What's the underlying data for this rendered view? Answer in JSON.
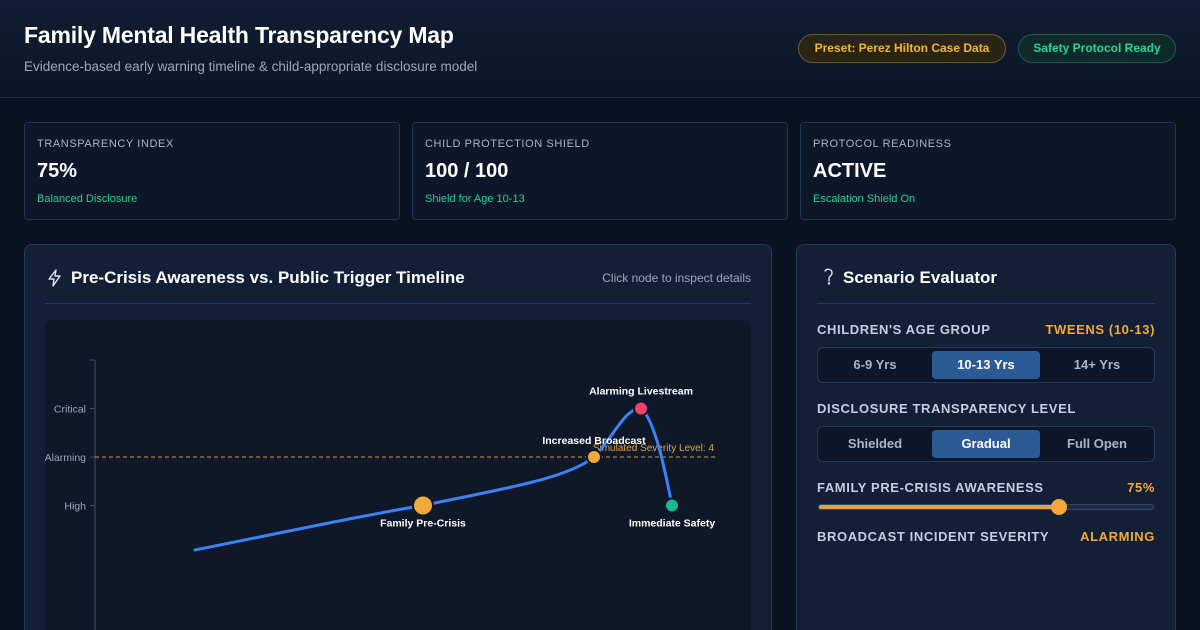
{
  "header": {
    "title": "Family Mental Health Transparency Map",
    "subtitle": "Evidence-based early warning timeline & child-appropriate disclosure model",
    "preset_badge": "Preset: Perez Hilton Case Data",
    "safety_badge": "Safety Protocol Ready"
  },
  "stats": [
    {
      "label": "TRANSPARENCY INDEX",
      "value": "75%",
      "note": "Balanced Disclosure"
    },
    {
      "label": "CHILD PROTECTION SHIELD",
      "value": "100 / 100",
      "note": "Shield for Age 10-13"
    },
    {
      "label": "PROTOCOL READINESS",
      "value": "ACTIVE",
      "note": "Escalation Shield On"
    }
  ],
  "timeline": {
    "title": "Pre-Crisis Awareness vs. Public Trigger Timeline",
    "hint": "Click node to inspect details",
    "threshold_label": "Simulated Severity Level: 4"
  },
  "chart_data": {
    "type": "line",
    "y_categories": [
      "High",
      "Alarming",
      "Critical"
    ],
    "y_levels": {
      "High": 3,
      "Alarming": 4,
      "Critical": 5
    },
    "threshold": 4,
    "series": [
      {
        "points": [
          {
            "label": "Family Pre-Crisis",
            "y": 3.0,
            "color": "#f2a93a"
          },
          {
            "label": "Increased Broadcast",
            "y": 4.0,
            "color": "#f2a93a"
          },
          {
            "label": "Alarming Livestream",
            "y": 5.0,
            "color": "#f0436a"
          },
          {
            "label": "Immediate Safety",
            "y": 3.0,
            "color": "#16b890"
          }
        ]
      }
    ],
    "colors": {
      "line": "#3b82f6",
      "threshold": "#e9a23b"
    }
  },
  "evaluator": {
    "title": "Scenario Evaluator",
    "age_group": {
      "label": "CHILDREN'S AGE GROUP",
      "value": "TWEENS (10-13)",
      "options": [
        "6-9 Yrs",
        "10-13 Yrs",
        "14+ Yrs"
      ],
      "selected": 1
    },
    "transparency": {
      "label": "DISCLOSURE TRANSPARENCY LEVEL",
      "options": [
        "Shielded",
        "Gradual",
        "Full Open"
      ],
      "selected": 1
    },
    "awareness": {
      "label": "FAMILY PRE-CRISIS AWARENESS",
      "value": "75%",
      "level": 0.72
    },
    "severity": {
      "label": "BROADCAST INCIDENT SEVERITY",
      "value": "ALARMING"
    }
  }
}
